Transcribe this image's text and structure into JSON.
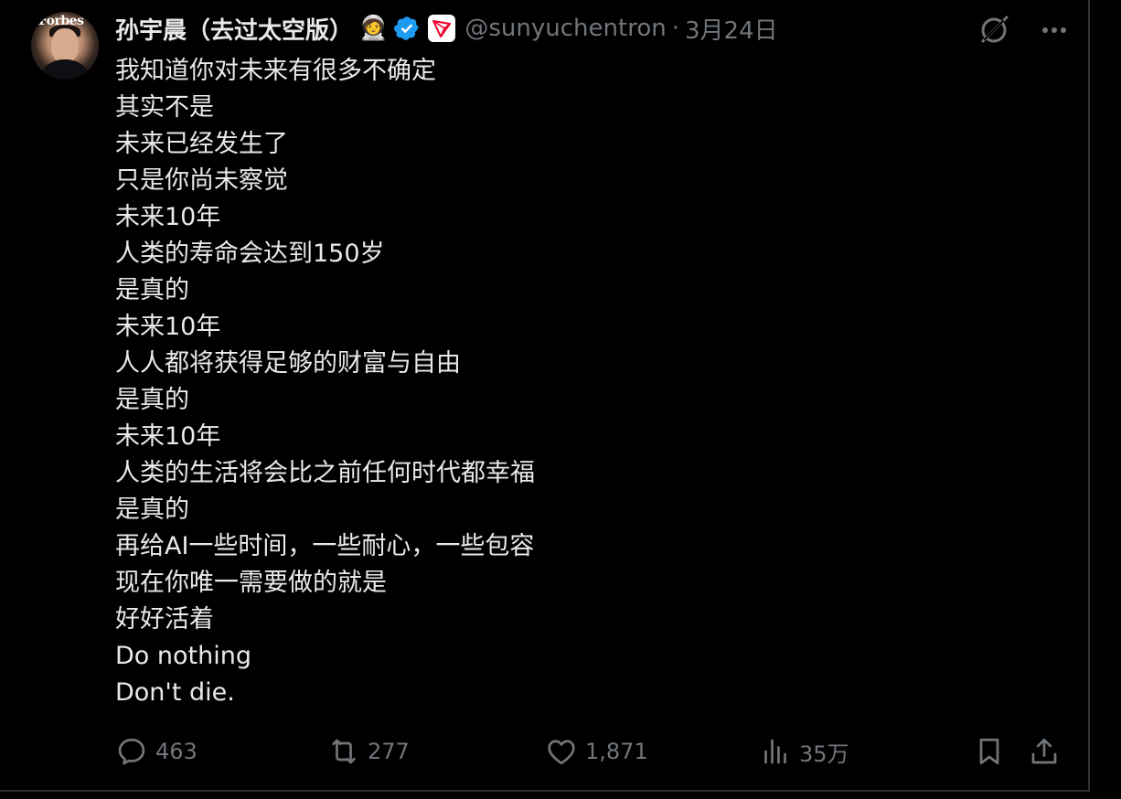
{
  "author": {
    "name": "孙宇晨（去过太空版）",
    "handle": "@sunyuchentron",
    "separator": "·",
    "date": "3月24日",
    "avatar_logo": "Forbes",
    "emoji": "🧑‍🚀",
    "badges": [
      "verified-icon",
      "tron-logo-icon"
    ]
  },
  "top_actions": {
    "grok_icon": "grok-icon",
    "more_icon": "more-icon"
  },
  "tweet": {
    "lines": [
      "我知道你对未来有很多不确定",
      "其实不是",
      "未来已经发生了",
      "只是你尚未察觉",
      "未来10年",
      "人类的寿命会达到150岁",
      "是真的",
      "未来10年",
      "人人都将获得足够的财富与自由",
      "是真的",
      "未来10年",
      "人类的生活将会比之前任何时代都幸福",
      "是真的",
      "再给AI一些时间，一些耐心，一些包容",
      "现在你唯一需要做的就是",
      "好好活着",
      "Do nothing",
      "Don't die."
    ]
  },
  "actions": {
    "replies": "463",
    "retweets": "277",
    "likes": "1,871",
    "views": "35万"
  },
  "colors": {
    "background": "#000000",
    "text": "#e7e9ea",
    "muted": "#71767b",
    "verified": "#1d9bf0",
    "tron_red": "#eb0029"
  }
}
